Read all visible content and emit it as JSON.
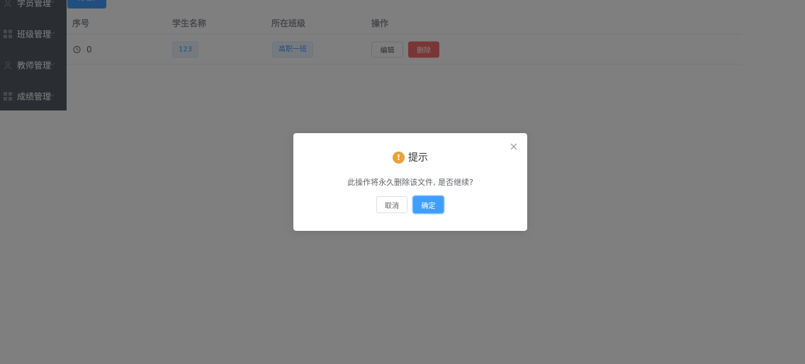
{
  "sidebar": {
    "items": [
      {
        "label": "学员管理",
        "icon": "user-icon"
      },
      {
        "label": "班级管理",
        "icon": "grid-icon"
      },
      {
        "label": "教师管理",
        "icon": "user-icon"
      },
      {
        "label": "成绩管理",
        "icon": "grid-icon"
      }
    ]
  },
  "toolbar": {
    "add_label": "添加"
  },
  "table": {
    "headers": [
      "序号",
      "学生名称",
      "所在班级",
      "操作"
    ],
    "rows": [
      {
        "index": "0",
        "student": "123",
        "class": "高职一班",
        "edit_label": "编辑",
        "delete_label": "删除"
      }
    ]
  },
  "dialog": {
    "title": "提示",
    "warning_glyph": "!",
    "message": "此操作将永久删除该文件, 是否继续?",
    "cancel_label": "取消",
    "confirm_label": "确定"
  },
  "colors": {
    "primary": "#409eff",
    "danger": "#f56c6c",
    "warning": "#e6a23c",
    "sidebar_bg": "#545c64"
  }
}
